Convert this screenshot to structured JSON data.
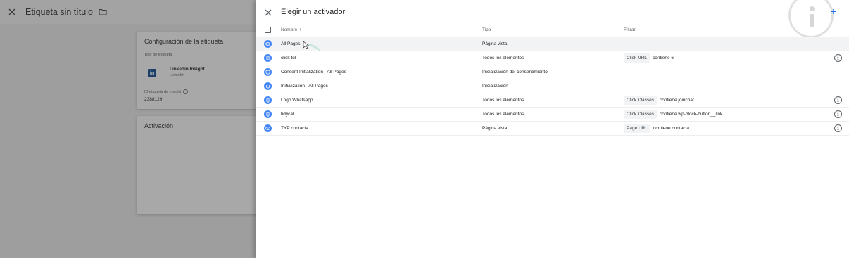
{
  "background": {
    "title": "Etiqueta sin título",
    "config_card": {
      "title": "Configuración de la etiqueta",
      "type_label": "Tipo de etiqueta",
      "tag_name": "Linkedin Insight",
      "tag_vendor": "LinkedIn",
      "logo_text": "in",
      "id_label": "ID etiqueta de Insight",
      "id_value": "2388129"
    },
    "activation_card": {
      "title": "Activación"
    }
  },
  "panel": {
    "title": "Elegir un activador",
    "add_label": "+",
    "columns": {
      "name": "Nombre",
      "sort": "↑",
      "type": "Tipo",
      "filter": "Filtrar"
    },
    "rows": [
      {
        "name": "All Pages",
        "type": "Página vista",
        "chip": "",
        "condition": "--",
        "icon": "eye-icon",
        "info": false
      },
      {
        "name": "click tel",
        "type": "Todos los elementos",
        "chip": "Click URL",
        "condition": "contiene 6",
        "icon": "click-icon",
        "info": true
      },
      {
        "name": "Consent Initialization - All Pages",
        "type": "Inicialización del consentimiento",
        "chip": "",
        "condition": "--",
        "icon": "shield-icon",
        "info": false
      },
      {
        "name": "Initialization - All Pages",
        "type": "Inicialización",
        "chip": "",
        "condition": "--",
        "icon": "power-icon",
        "info": false
      },
      {
        "name": "Logo Whatsapp",
        "type": "Todos los elementos",
        "chip": "Click Classes",
        "condition": "contiene joinchat",
        "icon": "click-icon",
        "info": true
      },
      {
        "name": "tidycal",
        "type": "Todos los elementos",
        "chip": "Click Classes",
        "condition": "contiene wp-block-button__link ...",
        "icon": "click-icon",
        "info": true
      },
      {
        "name": "TYP contacta",
        "type": "Página vista",
        "chip": "Page URL",
        "condition": "contiene contacta",
        "icon": "eye-icon",
        "info": true
      }
    ],
    "info_glyph": "i"
  },
  "colors": {
    "accent": "#4285f4",
    "overlay": "#9e9e9e"
  }
}
